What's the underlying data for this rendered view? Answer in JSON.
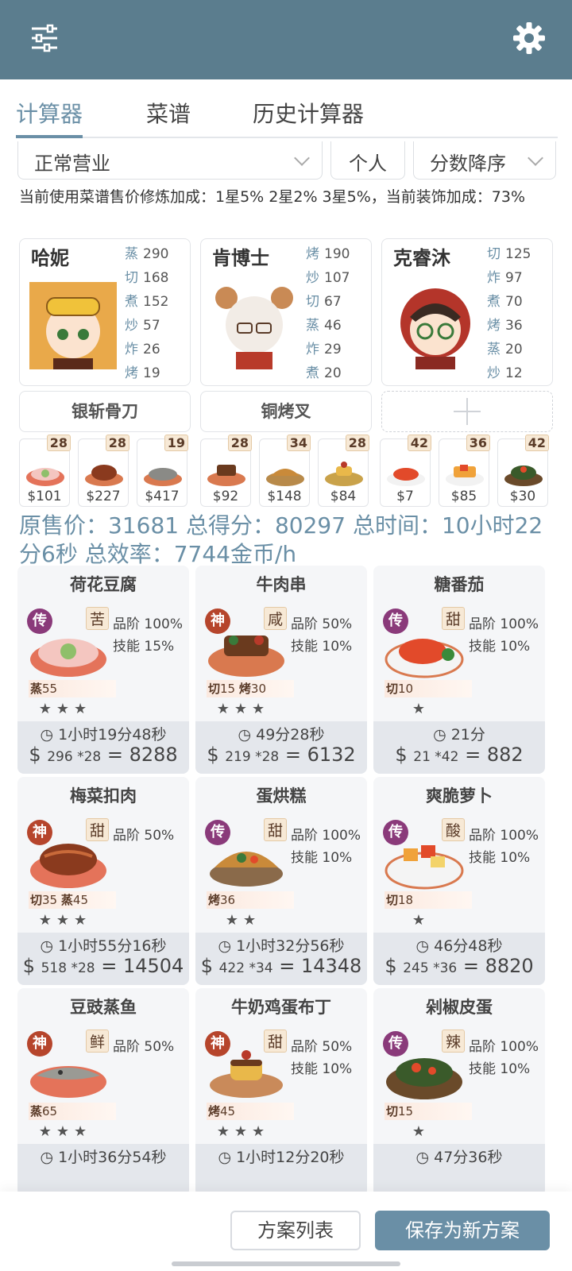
{
  "tabs": [
    "计算器",
    "菜谱",
    "历史计算器"
  ],
  "filters": {
    "mode": "正常营业",
    "scope": "个人",
    "sort": "分数降序"
  },
  "info_line": "当前使用菜谱售价修炼加成：1星5% 2星2% 3星5%，当前装饰加成：73%",
  "chefs": [
    {
      "name": "哈妮",
      "stats": [
        [
          "蒸",
          "290"
        ],
        [
          "切",
          "168"
        ],
        [
          "煮",
          "152"
        ],
        [
          "炒",
          "57"
        ],
        [
          "炸",
          "26"
        ],
        [
          "烤",
          "19"
        ]
      ]
    },
    {
      "name": "肯博士",
      "stats": [
        [
          "烤",
          "190"
        ],
        [
          "炒",
          "107"
        ],
        [
          "切",
          "67"
        ],
        [
          "蒸",
          "46"
        ],
        [
          "炸",
          "29"
        ],
        [
          "煮",
          "20"
        ]
      ]
    },
    {
      "name": "克睿沐",
      "stats": [
        [
          "切",
          "125"
        ],
        [
          "炸",
          "97"
        ],
        [
          "煮",
          "70"
        ],
        [
          "烤",
          "36"
        ],
        [
          "蒸",
          "20"
        ],
        [
          "炒",
          "12"
        ]
      ]
    }
  ],
  "tools": [
    "银斩骨刀",
    "铜烤叉"
  ],
  "mini_dishes": [
    {
      "count": "28",
      "price": "$101"
    },
    {
      "count": "28",
      "price": "$227"
    },
    {
      "count": "19",
      "price": "$417"
    },
    {
      "count": "28",
      "price": "$92"
    },
    {
      "count": "34",
      "price": "$148"
    },
    {
      "count": "28",
      "price": "$84"
    },
    {
      "count": "42",
      "price": "$7"
    },
    {
      "count": "36",
      "price": "$85"
    },
    {
      "count": "42",
      "price": "$30"
    }
  ],
  "summary": "原售价：31681 总得分：80297 总时间：10小时22分6秒 总效率：7744金币/h",
  "dishes": [
    {
      "name": "荷花豆腐",
      "rank": "传",
      "taste": "苦",
      "grade": "品阶 100%",
      "skill": "技能 15%",
      "skills": [
        [
          "蒸",
          "55"
        ]
      ],
      "stars": "★★★",
      "time": "1小时19分48秒",
      "unit": "296 *28",
      "total": "8288"
    },
    {
      "name": "牛肉串",
      "rank": "神",
      "taste": "咸",
      "grade": "品阶 50%",
      "skill": "技能 10%",
      "skills": [
        [
          "切",
          "15"
        ],
        [
          "烤",
          "30"
        ]
      ],
      "stars": "★★★",
      "time": "49分28秒",
      "unit": "219 *28",
      "total": "6132"
    },
    {
      "name": "糖番茄",
      "rank": "传",
      "taste": "甜",
      "grade": "品阶 100%",
      "skill": "技能 10%",
      "skills": [
        [
          "切",
          "10"
        ]
      ],
      "stars": "★",
      "time": "21分",
      "unit": "21 *42",
      "total": "882"
    },
    {
      "name": "梅菜扣肉",
      "rank": "神",
      "taste": "甜",
      "grade": "品阶 50%",
      "skill": "",
      "skills": [
        [
          "切",
          "35"
        ],
        [
          "蒸",
          "45"
        ]
      ],
      "stars": "★★★",
      "time": "1小时55分16秒",
      "unit": "518 *28",
      "total": "14504"
    },
    {
      "name": "蛋烘糕",
      "rank": "传",
      "taste": "甜",
      "grade": "品阶 100%",
      "skill": "技能 10%",
      "skills": [
        [
          "烤",
          "36"
        ]
      ],
      "stars": "★★",
      "time": "1小时32分56秒",
      "unit": "422 *34",
      "total": "14348"
    },
    {
      "name": "爽脆萝卜",
      "rank": "传",
      "taste": "酸",
      "grade": "品阶 100%",
      "skill": "技能 10%",
      "skills": [
        [
          "切",
          "18"
        ]
      ],
      "stars": "★",
      "time": "46分48秒",
      "unit": "245 *36",
      "total": "8820"
    },
    {
      "name": "豆豉蒸鱼",
      "rank": "神",
      "taste": "鲜",
      "grade": "品阶 50%",
      "skill": "",
      "skills": [
        [
          "蒸",
          "65"
        ]
      ],
      "stars": "★★★",
      "time": "1小时36分54秒",
      "unit": "",
      "total": ""
    },
    {
      "name": "牛奶鸡蛋布丁",
      "rank": "神",
      "taste": "甜",
      "grade": "品阶 50%",
      "skill": "技能 10%",
      "skills": [
        [
          "烤",
          "45"
        ]
      ],
      "stars": "★★★",
      "time": "1小时12分20秒",
      "unit": "",
      "total": ""
    },
    {
      "name": "剁椒皮蛋",
      "rank": "传",
      "taste": "辣",
      "grade": "品阶 100%",
      "skill": "技能 10%",
      "skills": [
        [
          "切",
          "15"
        ]
      ],
      "stars": "★",
      "time": "47分36秒",
      "unit": "",
      "total": ""
    }
  ],
  "buttons": {
    "list": "方案列表",
    "save": "保存为新方案"
  },
  "colors": {
    "header": "#5b7d8e",
    "accent": "#6a8fa6",
    "chuan": "#8a3a7a",
    "shen": "#b6452c"
  }
}
